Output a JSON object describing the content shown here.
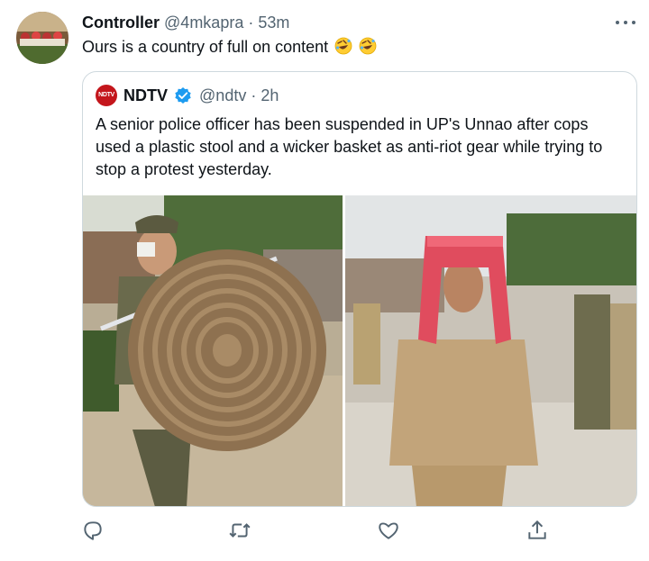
{
  "tweet": {
    "author_name": "Controller",
    "handle": "@4mkapra",
    "separator": "·",
    "time": "53m",
    "text": "Ours is a country of full on content",
    "emoji": [
      "rolling-on-floor-laughing",
      "rolling-on-floor-laughing"
    ]
  },
  "quote": {
    "logo_text": "NDTV",
    "author_name": "NDTV",
    "handle": "@ndtv",
    "separator": "·",
    "time": "2h",
    "text": "A senior police officer has been suspended in UP's Unnao after cops used a plastic stool and a wicker basket as anti-riot gear while trying to stop a protest yesterday.",
    "media": [
      "photo-officer-with-wicker-basket",
      "photo-officer-with-plastic-stool"
    ]
  },
  "actions": [
    "reply-icon",
    "retweet-icon",
    "like-icon",
    "share-icon"
  ],
  "colors": {
    "text": "#0f1419",
    "secondary": "#536471",
    "border": "#cfd9de",
    "verified": "#1d9bf0",
    "ndtv_red": "#c4161c"
  }
}
